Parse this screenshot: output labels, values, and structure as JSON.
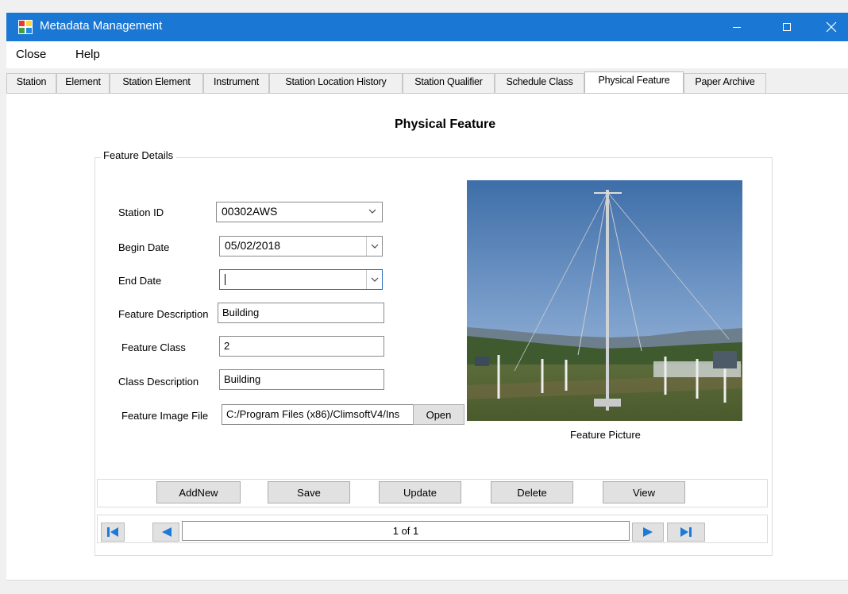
{
  "window": {
    "title": "Metadata Management"
  },
  "menu": [
    {
      "label": "Close"
    },
    {
      "label": "Help"
    }
  ],
  "tabs": [
    {
      "label": "Station"
    },
    {
      "label": "Element"
    },
    {
      "label": "Station Element"
    },
    {
      "label": "Instrument"
    },
    {
      "label": "Station Location History"
    },
    {
      "label": "Station Qualifier"
    },
    {
      "label": "Schedule Class"
    },
    {
      "label": "Physical Feature",
      "active": true
    },
    {
      "label": "Paper Archive"
    }
  ],
  "form": {
    "heading": "Physical Feature",
    "group_label": "Feature Details",
    "station_id": {
      "label": "Station ID",
      "value": "00302AWS"
    },
    "begin_date": {
      "label": "Begin Date",
      "value": "05/02/2018"
    },
    "end_date": {
      "label": "End Date",
      "value": ""
    },
    "feature_description": {
      "label": "Feature Description",
      "value": "Building"
    },
    "feature_class": {
      "label": "Feature Class",
      "value": "2"
    },
    "class_description": {
      "label": "Class Description",
      "value": "Building"
    },
    "feature_image_file": {
      "label": "Feature Image File",
      "value": "C:/Program Files (x86)/ClimsoftV4/Ins"
    },
    "open_label": "Open",
    "picture_caption": "Feature Picture"
  },
  "actions": [
    {
      "label": "AddNew"
    },
    {
      "label": "Save"
    },
    {
      "label": "Update"
    },
    {
      "label": "Delete"
    },
    {
      "label": "View"
    }
  ],
  "navigator": {
    "record": "1 of 1"
  },
  "colors": {
    "titlebar": "#1a77d4",
    "focus_border": "#2b6fbf",
    "nav_arrow": "#1e7ad8"
  },
  "icons": [
    "app-icon",
    "minimize-icon",
    "maximize-icon",
    "close-icon",
    "chevron-down-icon",
    "first-record-icon",
    "previous-record-icon",
    "next-record-icon",
    "last-record-icon"
  ]
}
